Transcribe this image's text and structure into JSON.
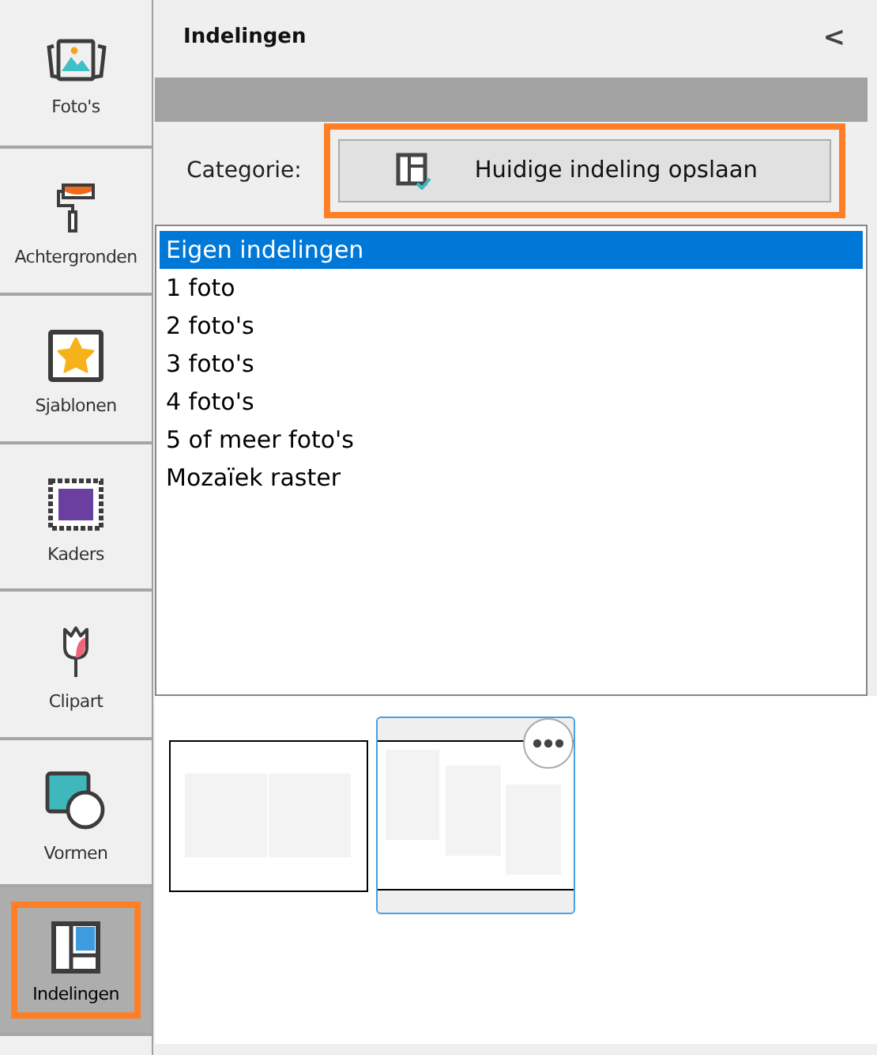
{
  "sidebar": {
    "items": [
      {
        "label": "Foto's",
        "kind": "photos",
        "selected": false
      },
      {
        "label": "Achtergronden",
        "kind": "roller",
        "selected": false
      },
      {
        "label": "Sjablonen",
        "kind": "star",
        "selected": false
      },
      {
        "label": "Kaders",
        "kind": "stamp",
        "selected": false
      },
      {
        "label": "Clipart",
        "kind": "tulip",
        "selected": false
      },
      {
        "label": "Vormen",
        "kind": "shapes",
        "selected": false
      },
      {
        "label": "Indelingen",
        "kind": "layout",
        "selected": true
      }
    ]
  },
  "panel": {
    "title": "Indelingen",
    "collapse": "<",
    "category_label": "Categorie:",
    "save_button": {
      "label": "Huidige indeling opslaan",
      "highlighted": true
    },
    "categories": [
      {
        "label": "Eigen indelingen",
        "selected": true
      },
      {
        "label": "1 foto",
        "selected": false
      },
      {
        "label": "2 foto's",
        "selected": false
      },
      {
        "label": "3 foto's",
        "selected": false
      },
      {
        "label": "4 foto's",
        "selected": false
      },
      {
        "label": "5 of meer foto's",
        "selected": false
      },
      {
        "label": "Mozaïek raster",
        "selected": false
      }
    ],
    "layouts": [
      {
        "kind": "two-side",
        "selected": false
      },
      {
        "kind": "three-staggered",
        "selected": true
      }
    ]
  }
}
